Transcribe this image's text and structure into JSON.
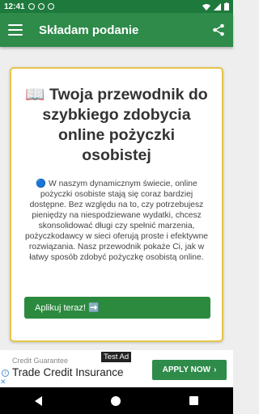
{
  "status": {
    "time": "12:41"
  },
  "appbar": {
    "title": "Składam podanie"
  },
  "card": {
    "heading": "📖 Twoja przewodnik do szybkiego zdobycia online pożyczki osobistej",
    "body": "🔵 W naszym dynamicznym świecie, online pożyczki osobiste stają się coraz bardziej dostępne. Bez względu na to, czy potrzebujesz pieniędzy na niespodziewane wydatki, chcesz skonsolidować długi czy spełnić marzenia, pożyczkodawcy w sieci oferują proste i efektywne rozwiązania. Nasz przewodnik pokaże Ci, jak w łatwy sposób zdobyć pożyczkę osobistą online.",
    "cta": "Aplikuj teraz! ➡️"
  },
  "ad": {
    "advertiser": "Credit Guarantee",
    "headline": "Trade Credit Insurance",
    "tag": "Test Ad",
    "button": "APPLY NOW",
    "button_arrow": "›"
  },
  "colors": {
    "appbar": "#2e8b4a",
    "statusbar": "#1e7a3c",
    "card_border": "#e6c54a",
    "cta": "#2b8a3e"
  }
}
